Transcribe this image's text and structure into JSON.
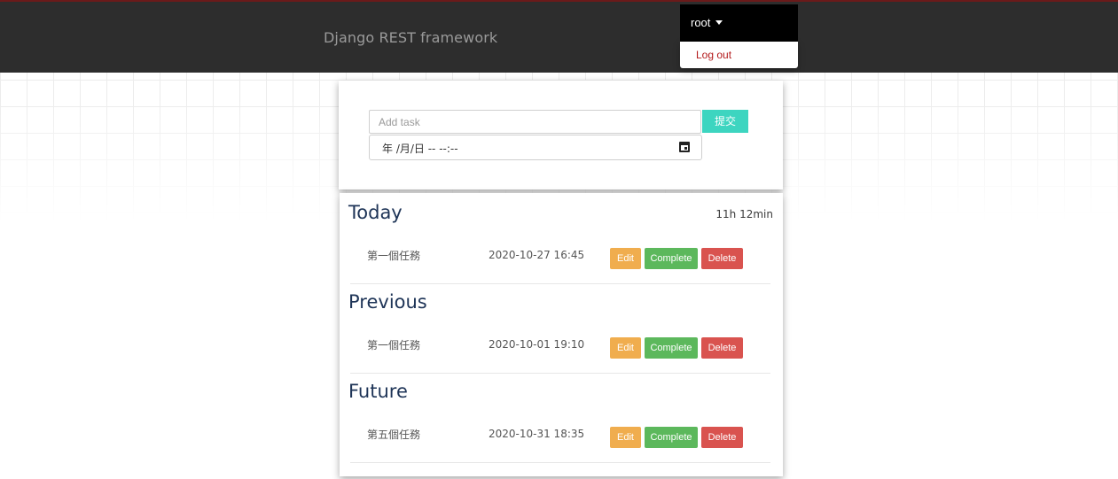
{
  "navbar": {
    "brand": "Django REST framework",
    "user_label": "root",
    "menu": {
      "logout_label": "Log out"
    }
  },
  "form": {
    "task_placeholder": "Add task",
    "task_value": "",
    "submit_label": "提交",
    "datetime_display": "年 /月/日 -- --:--"
  },
  "sections": [
    {
      "title": "Today",
      "right_text": "11h 12min",
      "tasks": [
        {
          "name": "第一個任務",
          "datetime": "2020-10-27 16:45",
          "edit_label": "Edit",
          "complete_label": "Complete",
          "delete_label": "Delete"
        }
      ]
    },
    {
      "title": "Previous",
      "tasks": [
        {
          "name": "第一個任務",
          "datetime": "2020-10-01 19:10",
          "edit_label": "Edit",
          "complete_label": "Complete",
          "delete_label": "Delete"
        }
      ]
    },
    {
      "title": "Future",
      "tasks": [
        {
          "name": "第五個任務",
          "datetime": "2020-10-31 18:35",
          "edit_label": "Edit",
          "complete_label": "Complete",
          "delete_label": "Delete"
        }
      ]
    }
  ],
  "colors": {
    "navbar_bg": "#2d2d2d",
    "submit": "#3dd5c0",
    "edit": "#f0ad4e",
    "complete": "#5cb85c",
    "delete": "#d9534f",
    "heading": "#1e3457",
    "logout": "#b3191a"
  },
  "icons": {
    "dropdown": "caret-down-icon",
    "datetime": "calendar-icon"
  }
}
